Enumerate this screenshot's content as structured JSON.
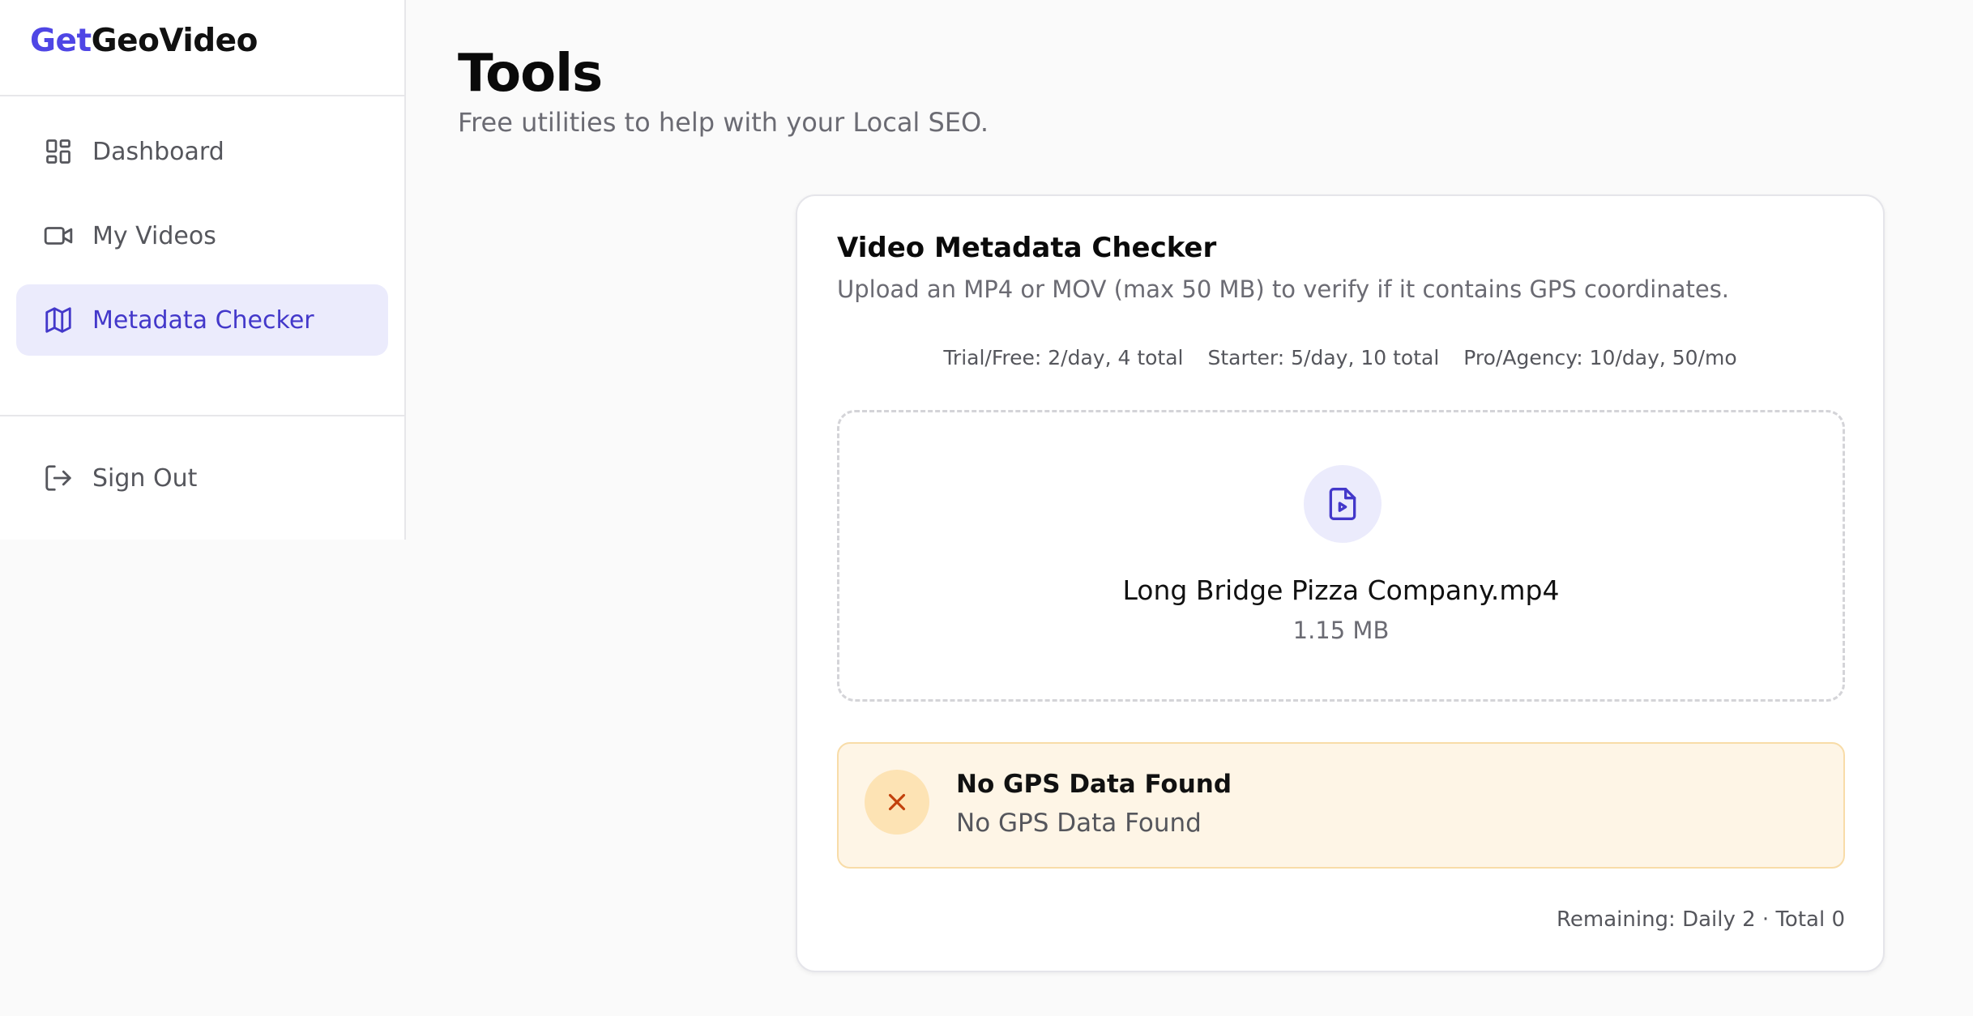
{
  "brand": {
    "part1": "Get",
    "part2": "GeoVideo",
    "accent_color": "#4f46e5"
  },
  "sidebar": {
    "items": [
      {
        "label": "Dashboard",
        "icon": "dashboard-grid-icon",
        "active": false
      },
      {
        "label": "My Videos",
        "icon": "video-camera-icon",
        "active": false
      },
      {
        "label": "Metadata Checker",
        "icon": "map-icon",
        "active": true
      }
    ],
    "signout": {
      "label": "Sign Out",
      "icon": "sign-out-icon"
    }
  },
  "page": {
    "title": "Tools",
    "subtitle": "Free utilities to help with your Local SEO."
  },
  "checker": {
    "title": "Video Metadata Checker",
    "description": "Upload an MP4 or MOV (max 50 MB) to verify if it contains GPS coordinates.",
    "limits": [
      "Trial/Free: 2/day, 4 total",
      "Starter: 5/day, 10 total",
      "Pro/Agency: 10/day, 50/mo"
    ],
    "file": {
      "name": "Long Bridge Pizza Company.mp4",
      "size": "1.15 MB",
      "icon": "file-video-icon"
    },
    "result": {
      "title": "No GPS Data Found",
      "message": "No GPS Data Found",
      "icon": "x-icon",
      "status_color": "#c2410c"
    },
    "remaining": "Remaining: Daily 2 · Total 0"
  }
}
